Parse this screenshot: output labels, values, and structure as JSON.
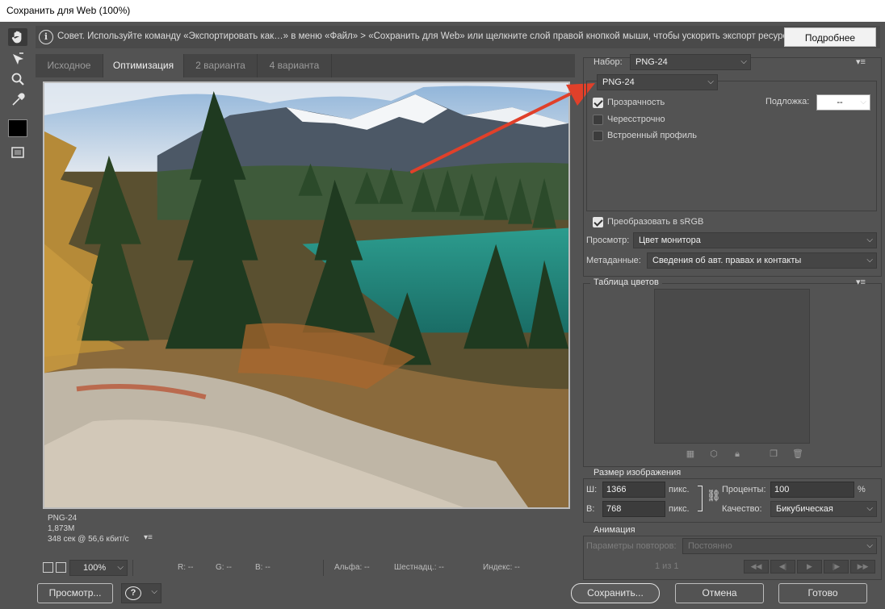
{
  "window": {
    "title": "Сохранить для Web (100%)"
  },
  "tip": {
    "text": "Совет. Используйте команду «Экспортировать как…» в меню «Файл» > «Сохранить для Web» или щелкните слой правой кнопкой мыши, чтобы ускорить экспорт ресурсов",
    "more_label": "Подробнее"
  },
  "tabs": [
    {
      "label": "Исходное",
      "active": false
    },
    {
      "label": "Оптимизация",
      "active": true
    },
    {
      "label": "2 варианта",
      "active": false
    },
    {
      "label": "4 варианта",
      "active": false
    }
  ],
  "image_info": {
    "format": "PNG-24",
    "size": "1,873M",
    "time": "348 сек @ 56,6 кбит/с",
    "menu_icon": "▾≡"
  },
  "statusbar": {
    "zoom": "100%",
    "r": "R: --",
    "g": "G: --",
    "b": "B: --",
    "alpha": "Альфа: --",
    "hex": "Шестнадц.: --",
    "index": "Индекс: --"
  },
  "buttons": {
    "preview": "Просмотр...",
    "save": "Сохранить...",
    "cancel": "Отмена",
    "done": "Готово"
  },
  "settings": {
    "preset_label": "Набор:",
    "preset_value": "PNG-24",
    "format_value": "PNG-24",
    "transparency": {
      "label": "Прозрачность",
      "checked": true
    },
    "matte_label": "Подложка:",
    "matte_value": "--",
    "interlaced": {
      "label": "Чересстрочно",
      "checked": false
    },
    "embed_profile": {
      "label": "Встроенный профиль",
      "checked": false
    },
    "convert_srgb": {
      "label": "Преобразовать в sRGB",
      "checked": true
    },
    "preview_label": "Просмотр:",
    "preview_value": "Цвет монитора",
    "metadata_label": "Метаданные:",
    "metadata_value": "Сведения об авт. правах и контакты"
  },
  "color_table": {
    "title": "Таблица цветов"
  },
  "image_size": {
    "title": "Размер изображения",
    "w_label": "Ш:",
    "w_value": "1366",
    "h_label": "В:",
    "h_value": "768",
    "unit": "пикс.",
    "percent_label": "Проценты:",
    "percent_value": "100",
    "percent_unit": "%",
    "quality_label": "Качество:",
    "quality_value": "Бикубическая"
  },
  "animation": {
    "title": "Анимация",
    "loop_label": "Параметры повторов:",
    "loop_value": "Постоянно",
    "frame": "1 из 1"
  },
  "colors": {
    "arrow": "#e0402a",
    "panel": "#535353",
    "dark": "#454545"
  }
}
